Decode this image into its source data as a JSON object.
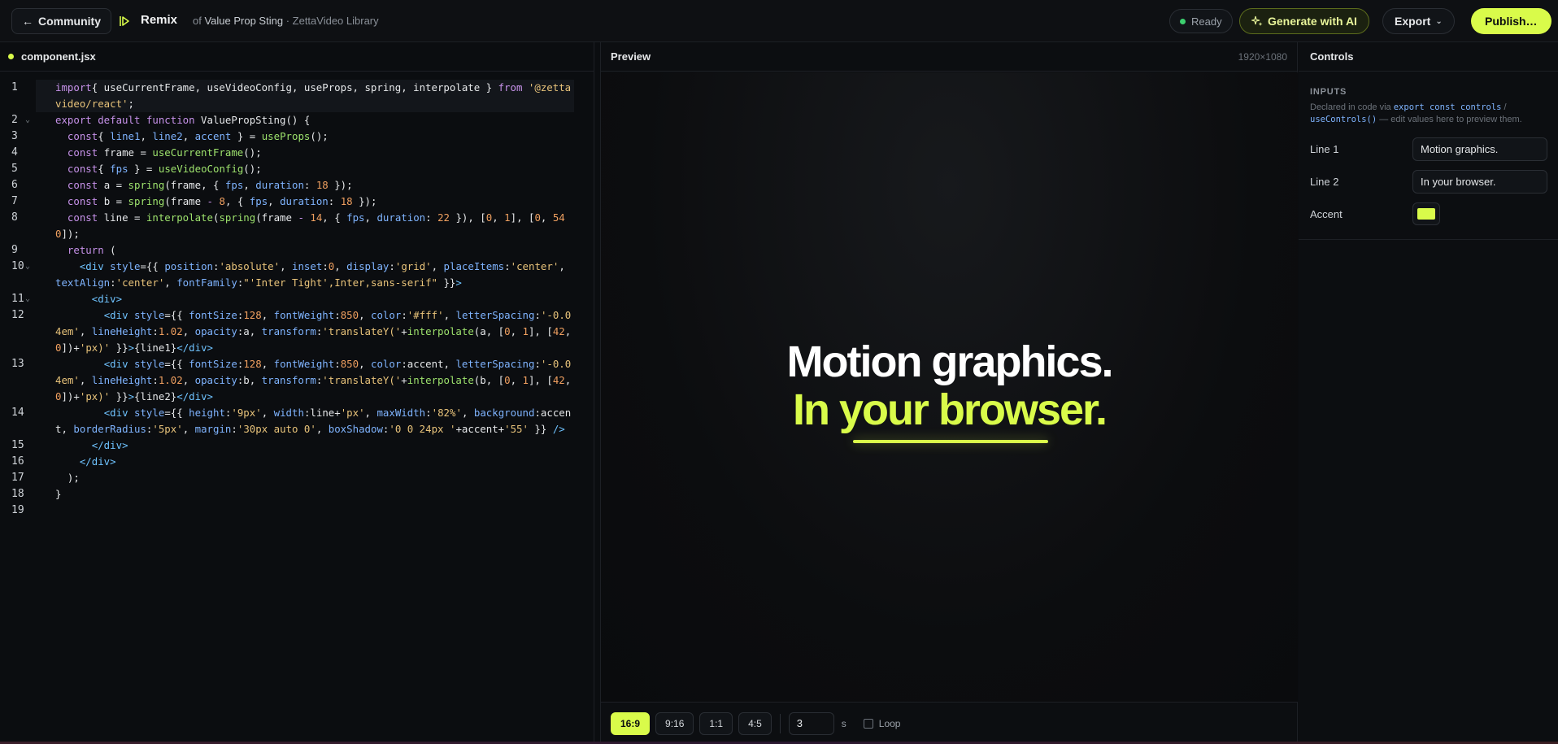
{
  "topbar": {
    "back_label": "Community",
    "remix_title": "Remix",
    "remix_prefix": "of",
    "remix_source": "Value Prop Sting",
    "remix_library": "· ZettaVideo Library",
    "status": "Ready",
    "status_color": "#3ccf6e",
    "generate_label": "Generate with AI",
    "export_label": "Export",
    "publish_label": "Publish…"
  },
  "editor": {
    "filename": "component.jsx",
    "lines": [
      {
        "num": "1",
        "fold": false
      },
      {
        "num": "2",
        "fold": true
      },
      {
        "num": "3",
        "fold": false
      },
      {
        "num": "4",
        "fold": false
      },
      {
        "num": "5",
        "fold": false
      },
      {
        "num": "6",
        "fold": false
      },
      {
        "num": "7",
        "fold": false
      },
      {
        "num": "8",
        "fold": false
      },
      {
        "num": "9",
        "fold": false
      },
      {
        "num": "10",
        "fold": true
      },
      {
        "num": "11",
        "fold": true
      },
      {
        "num": "12",
        "fold": false
      },
      {
        "num": "13",
        "fold": false
      },
      {
        "num": "14",
        "fold": false
      },
      {
        "num": "15",
        "fold": false
      },
      {
        "num": "16",
        "fold": false
      },
      {
        "num": "17",
        "fold": false
      },
      {
        "num": "18",
        "fold": false
      },
      {
        "num": "19",
        "fold": false
      }
    ],
    "code": [
      [
        [
          "k",
          "import"
        ],
        [
          "",
          "{ useCurrentFrame, useVideoConfig, useProps, spring, interpolate }"
        ],
        [
          "",
          ""
        ],
        [
          "k",
          " from"
        ],
        [
          "",
          " "
        ],
        [
          "s",
          "'@zettavideo/react'"
        ],
        [
          "",
          ";"
        ]
      ],
      [
        [
          "k",
          "export default function"
        ],
        [
          "",
          " ValuePropSting() {"
        ]
      ],
      [
        [
          "",
          "  "
        ],
        [
          "k",
          "const"
        ],
        [
          "",
          "{ "
        ],
        [
          "p",
          "line1"
        ],
        [
          "",
          ", "
        ],
        [
          "p",
          "line2"
        ],
        [
          "",
          ", "
        ],
        [
          "p",
          "accent"
        ],
        [
          "",
          " } = "
        ],
        [
          "f",
          "useProps"
        ],
        [
          "",
          "();"
        ]
      ],
      [
        [
          "",
          "  "
        ],
        [
          "k",
          "const"
        ],
        [
          "",
          " frame = "
        ],
        [
          "f",
          "useCurrentFrame"
        ],
        [
          "",
          "();"
        ]
      ],
      [
        [
          "",
          "  "
        ],
        [
          "k",
          "const"
        ],
        [
          "",
          "{ "
        ],
        [
          "p",
          "fps"
        ],
        [
          "",
          " } = "
        ],
        [
          "f",
          "useVideoConfig"
        ],
        [
          "",
          "();"
        ]
      ],
      [
        [
          "",
          "  "
        ],
        [
          "k",
          "const"
        ],
        [
          "",
          " a = "
        ],
        [
          "f",
          "spring"
        ],
        [
          "",
          "(frame, { "
        ],
        [
          "p",
          "fps"
        ],
        [
          "",
          ", "
        ],
        [
          "p",
          "duration"
        ],
        [
          "",
          ": "
        ],
        [
          "n",
          "18"
        ],
        [
          "",
          " });"
        ]
      ],
      [
        [
          "",
          "  "
        ],
        [
          "k",
          "const"
        ],
        [
          "",
          " b = "
        ],
        [
          "f",
          "spring"
        ],
        [
          "",
          "(frame "
        ],
        [
          "k",
          "-"
        ],
        [
          "",
          " "
        ],
        [
          "n",
          "8"
        ],
        [
          "",
          ", { "
        ],
        [
          "p",
          "fps"
        ],
        [
          "",
          ", "
        ],
        [
          "p",
          "duration"
        ],
        [
          "",
          ": "
        ],
        [
          "n",
          "18"
        ],
        [
          "",
          " });"
        ]
      ],
      [
        [
          "",
          "  "
        ],
        [
          "k",
          "const"
        ],
        [
          "",
          " line = "
        ],
        [
          "f",
          "interpolate"
        ],
        [
          "",
          "("
        ],
        [
          "f",
          "spring"
        ],
        [
          "",
          "(frame "
        ],
        [
          "k",
          "-"
        ],
        [
          "",
          " "
        ],
        [
          "n",
          "14"
        ],
        [
          "",
          ", { "
        ],
        [
          "p",
          "fps"
        ],
        [
          "",
          ", "
        ],
        [
          "p",
          "duration"
        ],
        [
          "",
          ": "
        ],
        [
          "n",
          "22"
        ],
        [
          "",
          " }), ["
        ],
        [
          "n",
          "0"
        ],
        [
          "",
          ", "
        ],
        [
          "n",
          "1"
        ],
        [
          "",
          "], ["
        ],
        [
          "n",
          "0"
        ],
        [
          "",
          ", "
        ],
        [
          "n",
          "540"
        ],
        [
          "",
          "]);"
        ]
      ],
      [
        [
          "",
          "  "
        ],
        [
          "k",
          "return"
        ],
        [
          "",
          " ("
        ]
      ],
      [
        [
          "",
          "    "
        ],
        [
          "t",
          "<div"
        ],
        [
          "",
          " "
        ],
        [
          "p",
          "style"
        ],
        [
          "",
          "={{ "
        ],
        [
          "p",
          "position"
        ],
        [
          "",
          ":"
        ],
        [
          "s",
          "'absolute'"
        ],
        [
          "",
          ", "
        ],
        [
          "p",
          "inset"
        ],
        [
          "",
          ":"
        ],
        [
          "n",
          "0"
        ],
        [
          "",
          ", "
        ],
        [
          "p",
          "display"
        ],
        [
          "",
          ":"
        ],
        [
          "s",
          "'grid'"
        ],
        [
          "",
          ", "
        ],
        [
          "p",
          "placeItems"
        ],
        [
          "",
          ":"
        ],
        [
          "s",
          "'center'"
        ],
        [
          "",
          ", "
        ],
        [
          "p",
          "textAlign"
        ],
        [
          "",
          ":"
        ],
        [
          "s",
          "'center'"
        ],
        [
          "",
          ", "
        ],
        [
          "p",
          "fontFamily"
        ],
        [
          "",
          ":"
        ],
        [
          "s",
          "\"'Inter Tight',Inter,sans-serif\""
        ],
        [
          "",
          " }}"
        ],
        [
          "t",
          ">"
        ]
      ],
      [
        [
          "",
          "      "
        ],
        [
          "t",
          "<div>"
        ]
      ],
      [
        [
          "",
          "        "
        ],
        [
          "t",
          "<div"
        ],
        [
          "",
          " "
        ],
        [
          "p",
          "style"
        ],
        [
          "",
          "={{ "
        ],
        [
          "p",
          "fontSize"
        ],
        [
          "",
          ":"
        ],
        [
          "n",
          "128"
        ],
        [
          "",
          ", "
        ],
        [
          "p",
          "fontWeight"
        ],
        [
          "",
          ":"
        ],
        [
          "n",
          "850"
        ],
        [
          "",
          ", "
        ],
        [
          "p",
          "color"
        ],
        [
          "",
          ":"
        ],
        [
          "s",
          "'#fff'"
        ],
        [
          "",
          ", "
        ],
        [
          "p",
          "letterSpacing"
        ],
        [
          "",
          ":"
        ],
        [
          "s",
          "'-0.04em'"
        ],
        [
          "",
          ", "
        ],
        [
          "p",
          "lineHeight"
        ],
        [
          "",
          ":"
        ],
        [
          "n",
          "1.02"
        ],
        [
          "",
          ", "
        ],
        [
          "p",
          "opacity"
        ],
        [
          "",
          ":a, "
        ],
        [
          "p",
          "transform"
        ],
        [
          "",
          ":"
        ],
        [
          "s",
          "'translateY('"
        ],
        [
          "",
          "+"
        ],
        [
          "f",
          "interpolate"
        ],
        [
          "",
          "(a, ["
        ],
        [
          "n",
          "0"
        ],
        [
          "",
          ", "
        ],
        [
          "n",
          "1"
        ],
        [
          "",
          "], ["
        ],
        [
          "n",
          "42"
        ],
        [
          "",
          ", "
        ],
        [
          "n",
          "0"
        ],
        [
          "",
          "])+"
        ],
        [
          "s",
          "'px)'"
        ],
        [
          "",
          " }}"
        ],
        [
          "t",
          ">"
        ],
        [
          "",
          "{line1}"
        ],
        [
          "t",
          "</div>"
        ]
      ],
      [
        [
          "",
          "        "
        ],
        [
          "t",
          "<div"
        ],
        [
          "",
          " "
        ],
        [
          "p",
          "style"
        ],
        [
          "",
          "={{ "
        ],
        [
          "p",
          "fontSize"
        ],
        [
          "",
          ":"
        ],
        [
          "n",
          "128"
        ],
        [
          "",
          ", "
        ],
        [
          "p",
          "fontWeight"
        ],
        [
          "",
          ":"
        ],
        [
          "n",
          "850"
        ],
        [
          "",
          ", "
        ],
        [
          "p",
          "color"
        ],
        [
          "",
          ":accent, "
        ],
        [
          "p",
          "letterSpacing"
        ],
        [
          "",
          ":"
        ],
        [
          "s",
          "'-0.04em'"
        ],
        [
          "",
          ", "
        ],
        [
          "p",
          "lineHeight"
        ],
        [
          "",
          ":"
        ],
        [
          "n",
          "1.02"
        ],
        [
          "",
          ", "
        ],
        [
          "p",
          "opacity"
        ],
        [
          "",
          ":b, "
        ],
        [
          "p",
          "transform"
        ],
        [
          "",
          ":"
        ],
        [
          "s",
          "'translateY('"
        ],
        [
          "",
          "+"
        ],
        [
          "f",
          "interpolate"
        ],
        [
          "",
          "(b, ["
        ],
        [
          "n",
          "0"
        ],
        [
          "",
          ", "
        ],
        [
          "n",
          "1"
        ],
        [
          "",
          "], ["
        ],
        [
          "n",
          "42"
        ],
        [
          "",
          ", "
        ],
        [
          "n",
          "0"
        ],
        [
          "",
          "])+"
        ],
        [
          "s",
          "'px)'"
        ],
        [
          "",
          " }}"
        ],
        [
          "t",
          ">"
        ],
        [
          "",
          "{line2}"
        ],
        [
          "t",
          "</div>"
        ]
      ],
      [
        [
          "",
          "        "
        ],
        [
          "t",
          "<div"
        ],
        [
          "",
          " "
        ],
        [
          "p",
          "style"
        ],
        [
          "",
          "={{ "
        ],
        [
          "p",
          "height"
        ],
        [
          "",
          ":"
        ],
        [
          "s",
          "'9px'"
        ],
        [
          "",
          ", "
        ],
        [
          "p",
          "width"
        ],
        [
          "",
          ":line+"
        ],
        [
          "s",
          "'px'"
        ],
        [
          "",
          ", "
        ],
        [
          "p",
          "maxWidth"
        ],
        [
          "",
          ":"
        ],
        [
          "s",
          "'82%'"
        ],
        [
          "",
          ", "
        ],
        [
          "p",
          "background"
        ],
        [
          "",
          ":accent, "
        ],
        [
          "p",
          "borderRadius"
        ],
        [
          "",
          ":"
        ],
        [
          "s",
          "'5px'"
        ],
        [
          "",
          ", "
        ],
        [
          "p",
          "margin"
        ],
        [
          "",
          ":"
        ],
        [
          "s",
          "'30px auto 0'"
        ],
        [
          "",
          ", "
        ],
        [
          "p",
          "boxShadow"
        ],
        [
          "",
          ":"
        ],
        [
          "s",
          "'0 0 24px '"
        ],
        [
          "",
          "+accent+"
        ],
        [
          "s",
          "'55'"
        ],
        [
          "",
          " }} "
        ],
        [
          "t",
          "/>"
        ]
      ],
      [
        [
          "",
          "      "
        ],
        [
          "t",
          "</div>"
        ]
      ],
      [
        [
          "",
          "    "
        ],
        [
          "t",
          "</div>"
        ]
      ],
      [
        [
          "",
          "  );"
        ]
      ],
      [
        [
          "",
          "}"
        ]
      ],
      [
        [
          "",
          ""
        ]
      ]
    ]
  },
  "preview": {
    "label": "Preview",
    "resolution": "1920×1080",
    "line1": "Motion graphics.",
    "line2": "In your browser.",
    "accent_color": "#d9fb4a",
    "aspect_ratios": [
      "16:9",
      "9:16",
      "1:1",
      "4:5"
    ],
    "selected_aspect": "16:9",
    "duration_value": "3",
    "duration_unit": "s",
    "loop_label": "Loop",
    "loop_checked": false
  },
  "controls": {
    "title": "Controls",
    "inputs_heading": "INPUTS",
    "desc_prefix": "Declared in code via ",
    "desc_code1": "export const controls",
    "desc_sep": " / ",
    "desc_code2": "useControls()",
    "desc_suffix": " — edit values here to preview them.",
    "line1_label": "Line 1",
    "line1_value": "Motion graphics.",
    "line2_label": "Line 2",
    "line2_value": "In your browser.",
    "accent_label": "Accent",
    "accent_value": "#d9fb4a"
  }
}
